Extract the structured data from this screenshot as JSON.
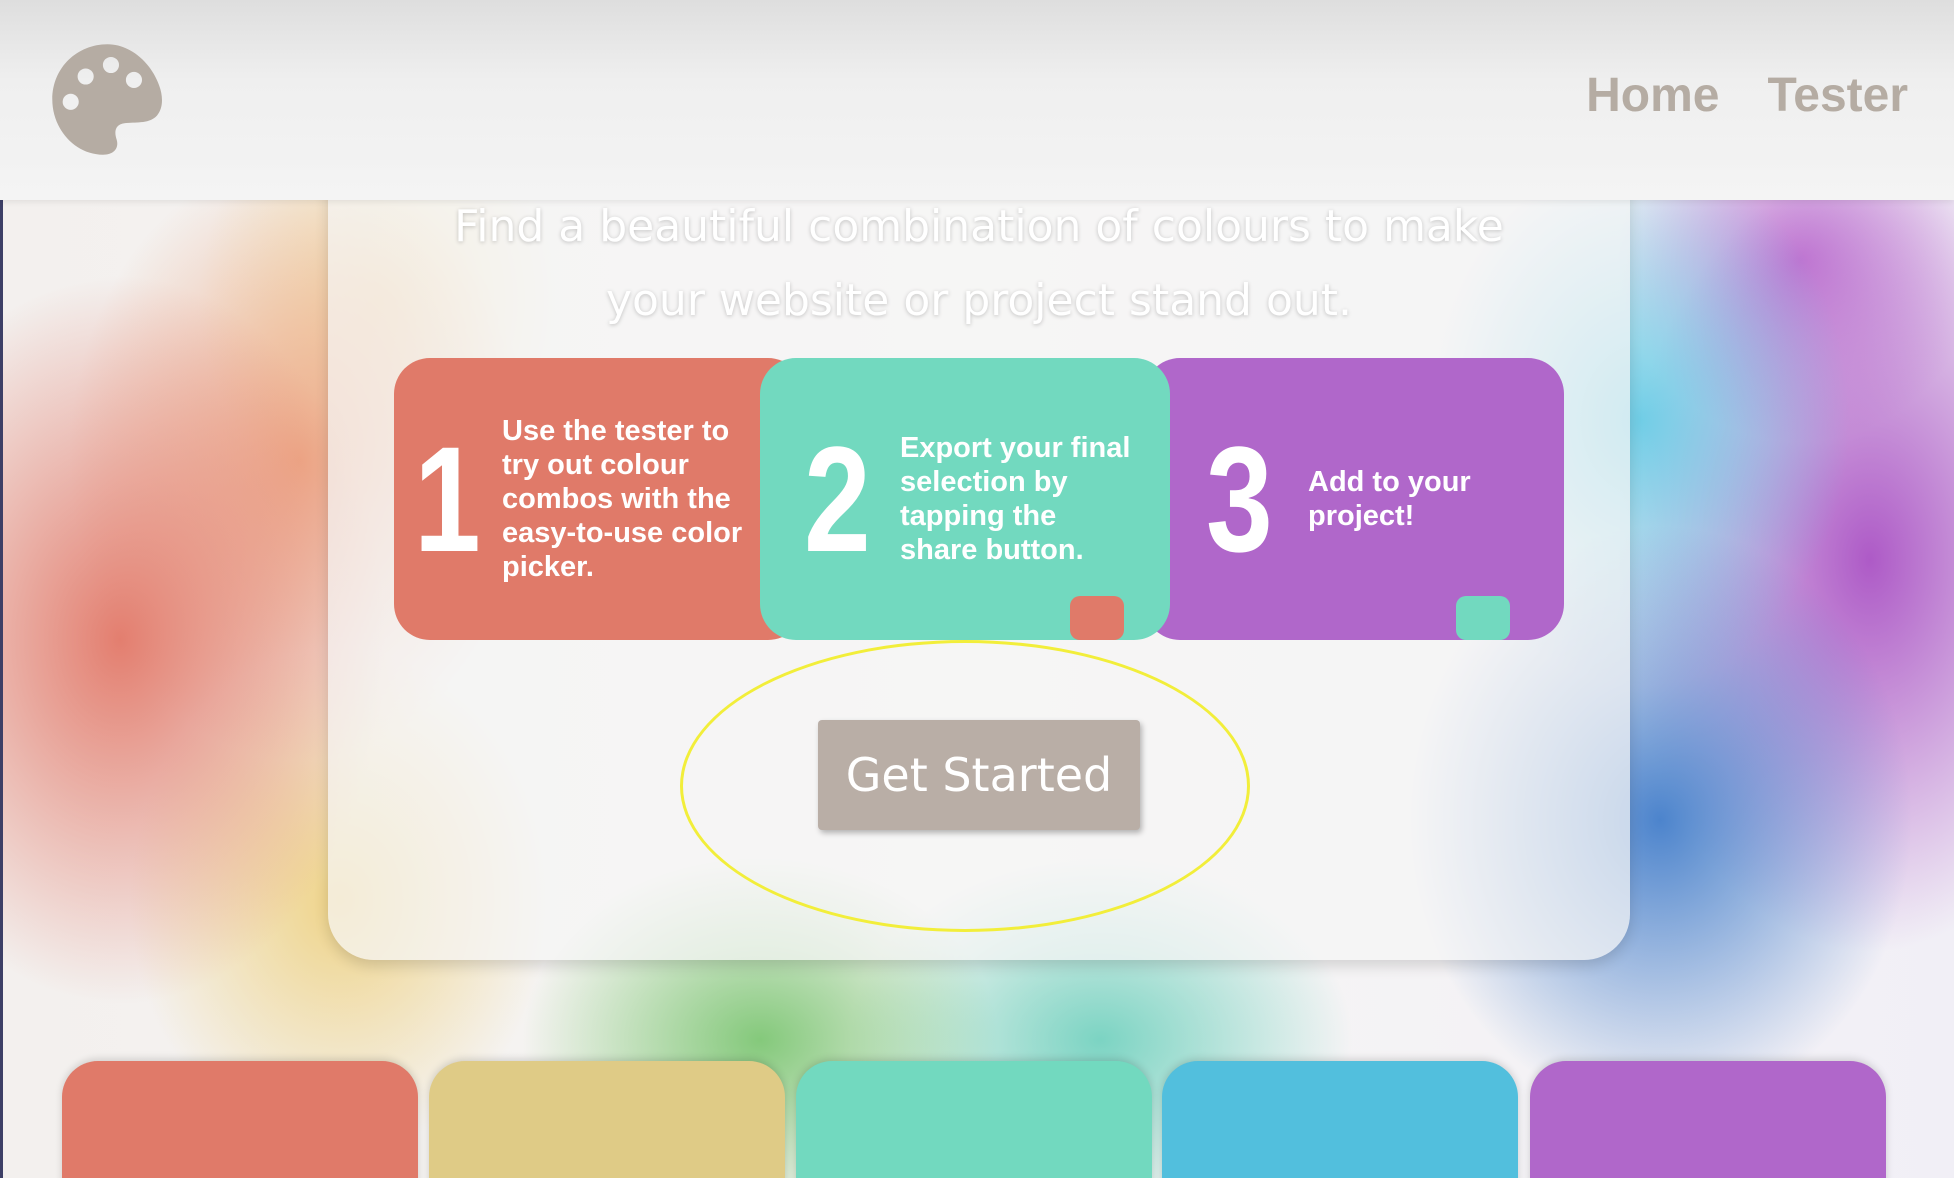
{
  "header": {
    "logo_icon": "palette-icon",
    "nav": [
      {
        "label": "Home"
      },
      {
        "label": "Tester"
      }
    ]
  },
  "hero": {
    "tagline_line1": "Find a beautiful combination of colours to make",
    "tagline_line2": "your website or project stand out.",
    "steps": [
      {
        "number": "1",
        "text": "Use the tester to try out colour combos with the easy-to-use color picker.",
        "color": "#e07a69"
      },
      {
        "number": "2",
        "text": "Export your final selection by tapping the share button.",
        "color": "#72d9bf"
      },
      {
        "number": "3",
        "text": "Add to your project!",
        "color": "#b067ca"
      }
    ],
    "cta_label": "Get Started",
    "highlight_color": "#f2ee3a"
  },
  "swatches": [
    {
      "name": "red",
      "color": "#e07a69"
    },
    {
      "name": "yellow",
      "color": "#dfcb86"
    },
    {
      "name": "teal",
      "color": "#72d9bf"
    },
    {
      "name": "blue",
      "color": "#52bfdd"
    },
    {
      "name": "purple",
      "color": "#b067ca"
    }
  ],
  "theme": {
    "header_bg": "#efefef",
    "nav_color": "#b5aca3",
    "button_bg": "#b9aea6"
  }
}
